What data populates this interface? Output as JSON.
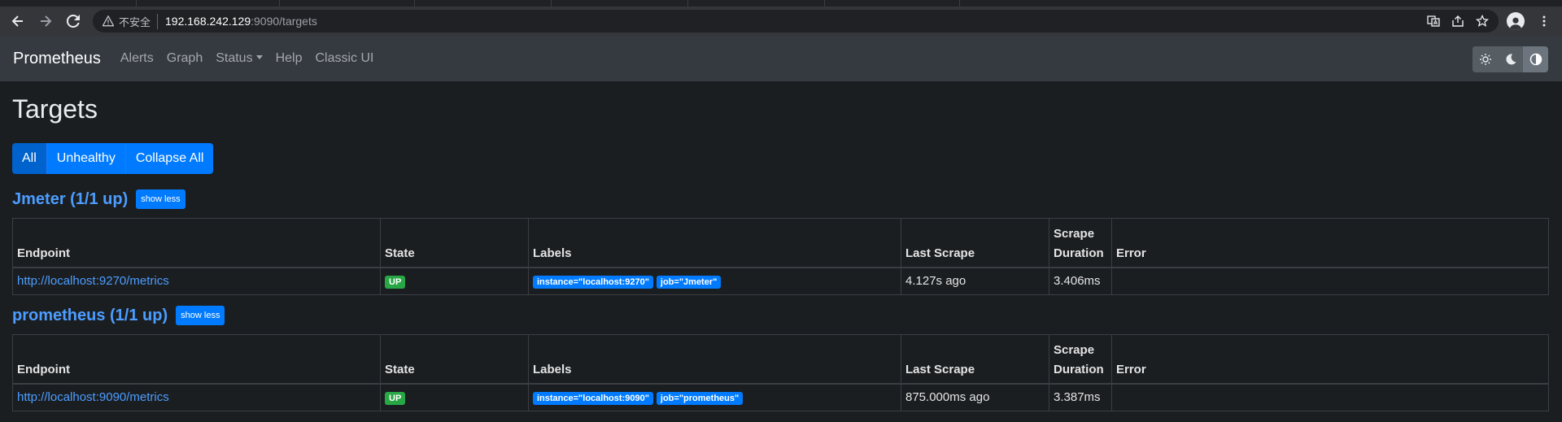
{
  "browser": {
    "insecure_label": "不安全",
    "url_host": "192.168.242.129",
    "url_path": ":9090/targets"
  },
  "navbar": {
    "brand": "Prometheus",
    "links": [
      "Alerts",
      "Graph",
      "Status",
      "Help",
      "Classic UI"
    ]
  },
  "page": {
    "title": "Targets",
    "filters": {
      "all": "All",
      "unhealthy": "Unhealthy",
      "collapse": "Collapse All"
    }
  },
  "table_headers": {
    "endpoint": "Endpoint",
    "state": "State",
    "labels": "Labels",
    "last_scrape": "Last Scrape",
    "scrape_duration": "Scrape Duration",
    "error": "Error"
  },
  "pools": [
    {
      "title": "Jmeter (1/1 up)",
      "toggle": "show less",
      "rows": [
        {
          "endpoint": "http://localhost:9270/metrics",
          "state": "UP",
          "labels": [
            "instance=\"localhost:9270\"",
            "job=\"Jmeter\""
          ],
          "last_scrape": "4.127s ago",
          "duration": "3.406ms",
          "error": ""
        }
      ]
    },
    {
      "title": "prometheus (1/1 up)",
      "toggle": "show less",
      "rows": [
        {
          "endpoint": "http://localhost:9090/metrics",
          "state": "UP",
          "labels": [
            "instance=\"localhost:9090\"",
            "job=\"prometheus\""
          ],
          "last_scrape": "875.000ms ago",
          "duration": "3.387ms",
          "error": ""
        }
      ]
    }
  ],
  "colors": {
    "accent": "#007bff",
    "up": "#28a745",
    "background": "#1b1e21",
    "navbar": "#343a40"
  }
}
